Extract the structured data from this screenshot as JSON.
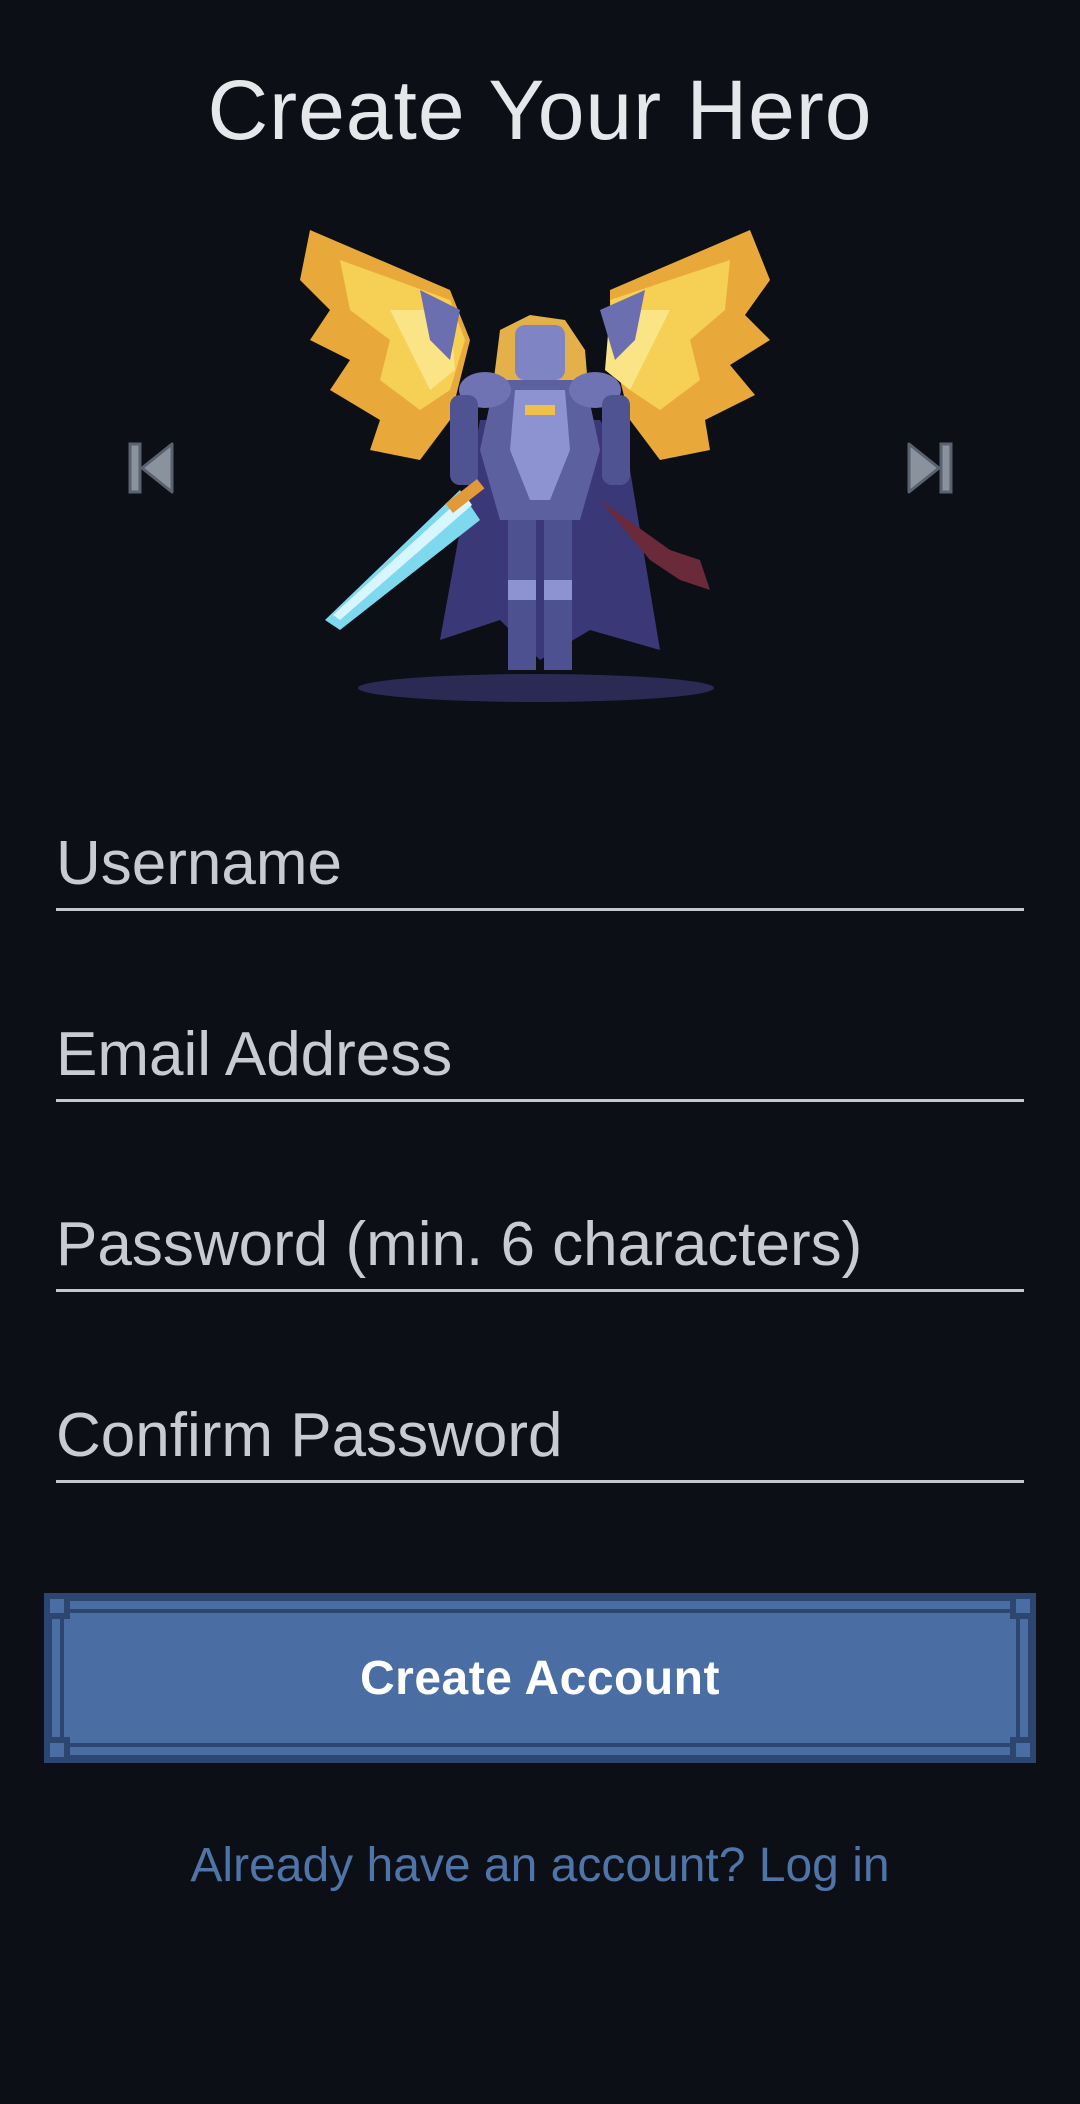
{
  "page": {
    "title": "Create Your Hero"
  },
  "hero_carousel": {
    "prev_icon": "skip-previous-icon",
    "next_icon": "skip-next-icon",
    "image": "pixel-art winged armored hero with sword"
  },
  "form": {
    "username_placeholder": "Username",
    "email_placeholder": "Email Address",
    "password_placeholder": "Password (min. 6 characters)",
    "confirm_placeholder": "Confirm Password",
    "submit_label": "Create Account",
    "login_link": "Already have an account? Log in"
  },
  "colors": {
    "background": "#0c0f16",
    "button_fill": "#4a6ea3",
    "button_border": "#2c4670",
    "link": "#4f74a8",
    "field_line": "#c4c7cd"
  }
}
